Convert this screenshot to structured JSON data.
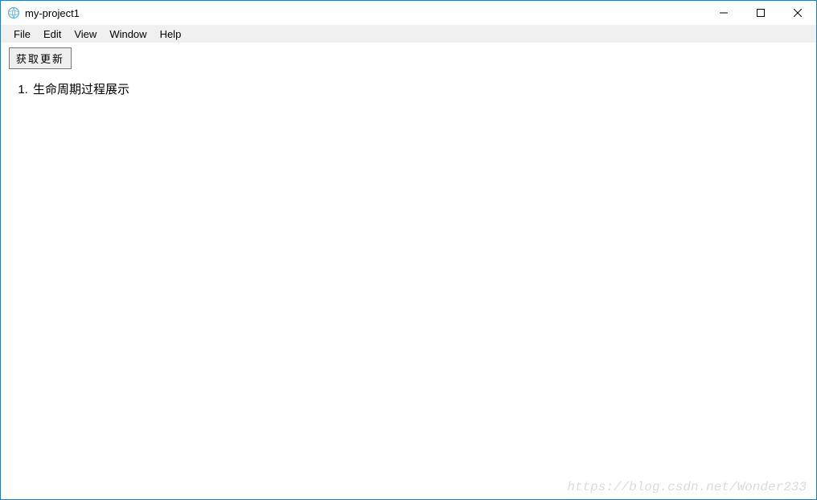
{
  "window": {
    "title": "my-project1"
  },
  "menu": {
    "items": [
      "File",
      "Edit",
      "View",
      "Window",
      "Help"
    ]
  },
  "toolbar": {
    "update_button": "获取更新"
  },
  "list": {
    "items": [
      "生命周期过程展示"
    ]
  },
  "watermark": "https://blog.csdn.net/Wonder233"
}
